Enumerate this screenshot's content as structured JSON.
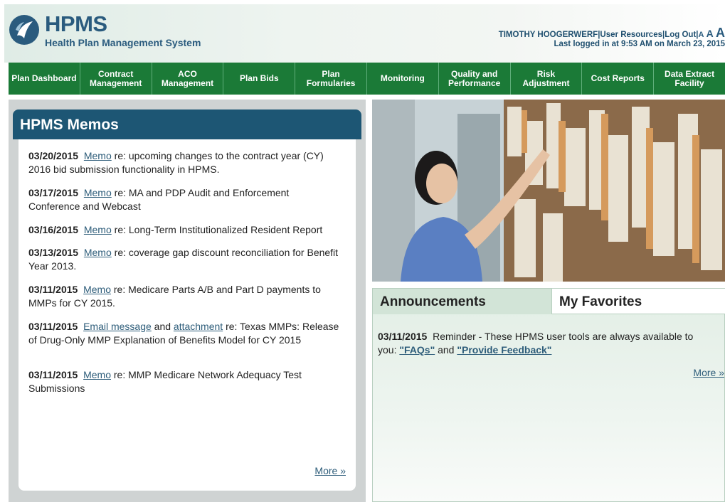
{
  "header": {
    "title": "HPMS",
    "subtitle": "Health Plan Management System",
    "user": "TIMOTHY HOOGERWERF",
    "user_resources": "User Resources",
    "logout": "Log Out",
    "font_small": "A",
    "font_medium": "A",
    "font_large": "A",
    "last_login": "Last logged in at 9:53 AM on March 23, 2015"
  },
  "nav": [
    {
      "label": "Plan Dashboard"
    },
    {
      "label": "Contract\nManagement"
    },
    {
      "label": "ACO\nManagement"
    },
    {
      "label": "Plan Bids"
    },
    {
      "label": "Plan\nFormularies"
    },
    {
      "label": "Monitoring"
    },
    {
      "label": "Quality and\nPerformance"
    },
    {
      "label": "Risk\nAdjustment"
    },
    {
      "label": "Cost Reports"
    },
    {
      "label": "Data Extract\nFacility"
    }
  ],
  "memos": {
    "title": "HPMS Memos",
    "more": "More »",
    "items": [
      {
        "date": "03/20/2015",
        "link": "Memo",
        "text": " re: upcoming changes to the contract year (CY) 2016 bid submission functionality in HPMS."
      },
      {
        "date": "03/17/2015",
        "link": "Memo",
        "text": " re: MA and PDP Audit and Enforcement Conference and Webcast"
      },
      {
        "date": "03/16/2015",
        "link": "Memo",
        "text": " re: Long-Term Institutionalized Resident Report"
      },
      {
        "date": "03/13/2015",
        "link": "Memo",
        "text": " re: coverage gap discount reconciliation for Benefit Year 2013."
      },
      {
        "date": "03/11/2015",
        "link": "Memo",
        "text": " re: Medicare Parts A/B and Part D payments to MMPs for CY 2015."
      },
      {
        "date": "03/11/2015",
        "link": "Email message",
        "mid": " and ",
        "link2": "attachment",
        "text": " re: Texas MMPs: Release of Drug-Only MMP Explanation of Benefits Model for CY 2015"
      },
      {
        "date": "03/11/2015",
        "link": "Memo",
        "text": " re: MMP Medicare Network Adequacy Test Submissions"
      }
    ]
  },
  "tabs": {
    "announcements": "Announcements",
    "favorites": "My Favorites"
  },
  "announcement": {
    "date": "03/11/2015",
    "text": "Reminder - These HPMS user tools are always available to you: ",
    "link1": "\"FAQs\"",
    "mid": " and ",
    "link2": "\"Provide Feedback\"",
    "more": "More »"
  },
  "colors": {
    "brand_blue": "#2a5b7e",
    "nav_green": "#1b7a37",
    "memo_header": "#1d5674"
  }
}
